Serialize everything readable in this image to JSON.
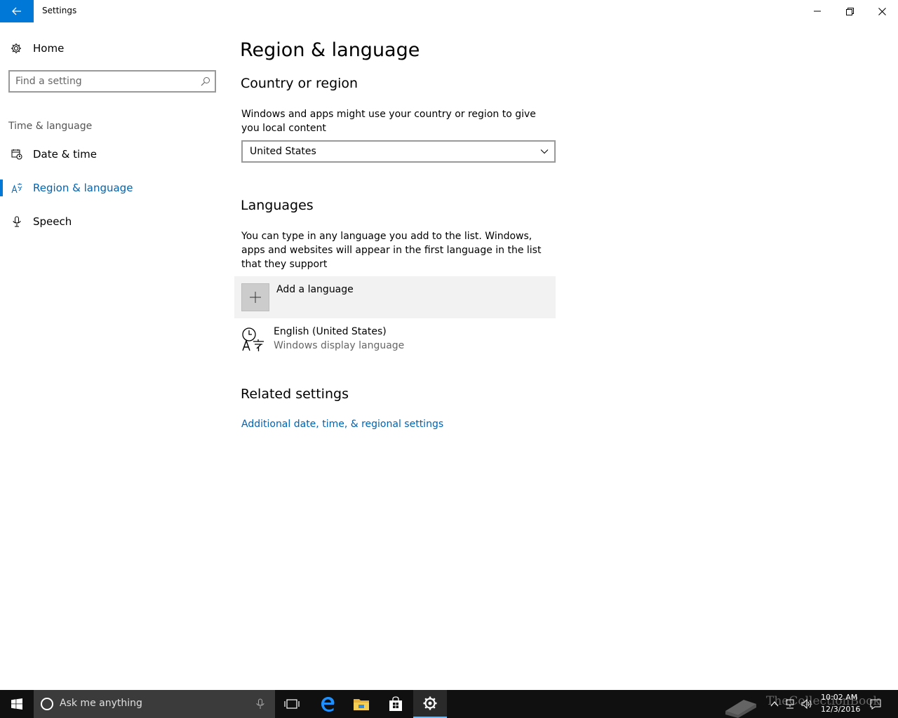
{
  "window": {
    "title": "Settings"
  },
  "sidebar": {
    "home_label": "Home",
    "search_placeholder": "Find a setting",
    "group_label": "Time & language",
    "items": [
      {
        "label": "Date & time"
      },
      {
        "label": "Region & language",
        "active": true
      },
      {
        "label": "Speech"
      }
    ]
  },
  "main": {
    "page_title": "Region & language",
    "country_section": {
      "title": "Country or region",
      "description": "Windows and apps might use your country or region to give you local content",
      "selected": "United States"
    },
    "languages_section": {
      "title": "Languages",
      "description": "You can type in any language you add to the list. Windows, apps and websites will appear in the first language in the list that they support",
      "add_label": "Add a language",
      "languages": [
        {
          "name": "English (United States)",
          "subtitle": "Windows display language"
        }
      ]
    },
    "related_section": {
      "title": "Related settings",
      "link": "Additional date, time, & regional settings"
    }
  },
  "taskbar": {
    "search_text": "Ask me anything",
    "time": "10:02 AM",
    "date": "12/3/2016",
    "watermark": "TheCollectionBook"
  },
  "colors": {
    "accent": "#0078d7",
    "link": "#0063b1",
    "taskbar": "#101010"
  }
}
